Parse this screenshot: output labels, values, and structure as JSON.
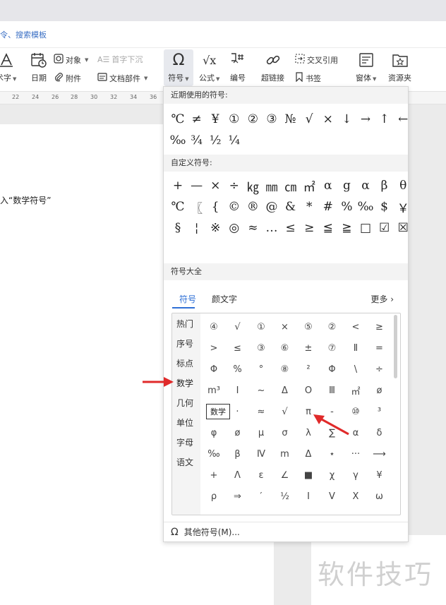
{
  "menubar": {
    "search_text": "令、搜索模板"
  },
  "ribbon": {
    "art_label": "术字",
    "date_label": "日期",
    "object_label": "对象",
    "attachment_label": "附件",
    "dropcap_label": "首字下沉",
    "docpart_label": "文档部件",
    "symbol_label": "符号",
    "formula_label": "公式",
    "numbering_label": "编号",
    "hyperlink_label": "超链接",
    "crossref_label": "交叉引用",
    "bookmark_label": "书签",
    "window_label": "窗体",
    "resource_label": "资源夹"
  },
  "ruler": [
    "22",
    "24",
    "26",
    "28",
    "30",
    "32",
    "34",
    "36"
  ],
  "document": {
    "line_text": "入“数学符号”"
  },
  "panel": {
    "recent_title": "近期使用的符号:",
    "recent": [
      "℃",
      "≠",
      "¥",
      "①",
      "②",
      "③",
      "№",
      "√",
      "×",
      "↓",
      "→",
      "↑",
      "←",
      "‰",
      "¾",
      "½",
      "¼"
    ],
    "custom_title": "自定义符号:",
    "custom": [
      "+",
      "—",
      "×",
      "÷",
      "㎏",
      "㎜",
      "㎝",
      "㎡",
      "α",
      "g",
      "α",
      "β",
      "θ",
      "℃",
      "〖",
      "{",
      "©",
      "®",
      "@",
      "&",
      "*",
      "#",
      "%",
      "‰",
      "$",
      "￥",
      "§",
      "¦",
      "※",
      "◎",
      "≈",
      "…",
      "≤",
      "≥",
      "≦",
      "≧",
      "□",
      "☑",
      "☒"
    ],
    "all_title": "符号大全",
    "tabs": [
      "符号",
      "颜文字"
    ],
    "more_label": "更多",
    "categories": [
      "热门",
      "序号",
      "标点",
      "数学",
      "几何",
      "单位",
      "字母",
      "语文"
    ],
    "symbols": [
      [
        "④",
        "√",
        "①",
        "×",
        "⑤",
        "②",
        "<",
        "≥"
      ],
      [
        ">",
        "≤",
        "③",
        "⑥",
        "±",
        "⑦",
        "Ⅱ",
        "="
      ],
      [
        "Φ",
        "%",
        "°",
        "⑧",
        "²",
        "Φ",
        "\\",
        "÷"
      ],
      [
        "m³",
        "Ⅰ",
        "~",
        "Δ",
        "O",
        "Ⅲ",
        "㎡",
        "ø"
      ],
      [
        "",
        "·",
        "≈",
        "√",
        "π",
        "-",
        "⑩",
        "³"
      ],
      [
        "φ",
        "ø",
        "μ",
        "σ",
        "λ",
        "∑",
        "α",
        "δ"
      ],
      [
        "‰",
        "β",
        "Ⅳ",
        "m",
        "Δ",
        "⋆",
        "···",
        "⟶"
      ],
      [
        "+",
        "Λ",
        "ε",
        "∠",
        "■",
        "χ",
        "γ",
        "¥"
      ],
      [
        "ρ",
        "⇒",
        "′",
        "½",
        "Ⅰ",
        "Ⅴ",
        "Ⅹ",
        "ω"
      ]
    ],
    "tooltip": "数学",
    "footer_label": "其他符号(M)..."
  },
  "watermark": "软件技巧",
  "colors": {
    "accent": "#2f70d6",
    "arrow": "#e02a2a"
  }
}
